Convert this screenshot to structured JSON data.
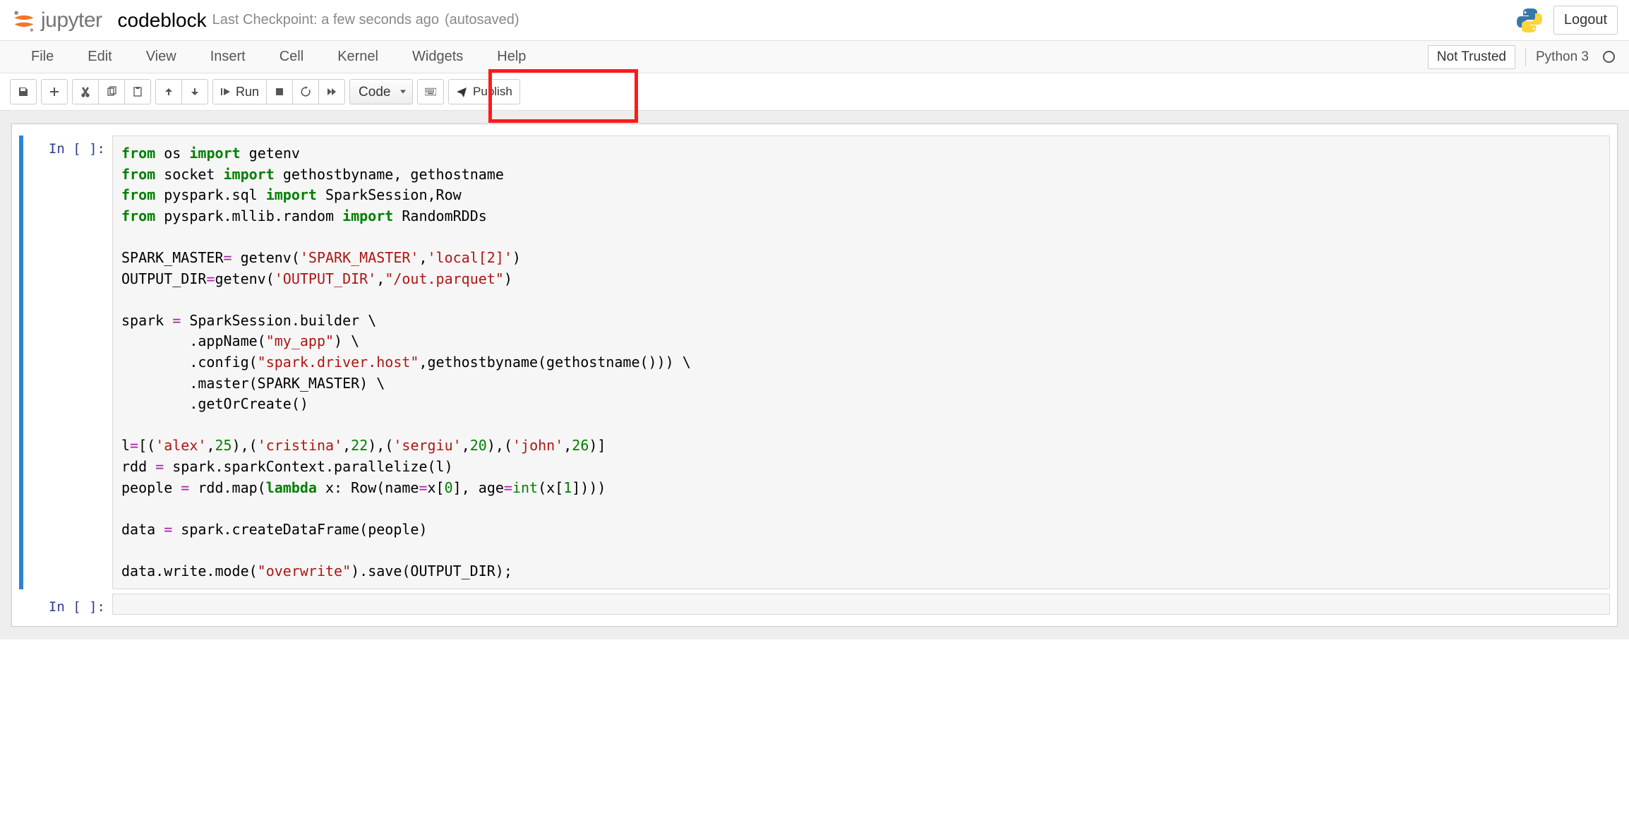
{
  "header": {
    "logo_text": "jupyter",
    "notebook_name": "codeblock",
    "checkpoint": "Last Checkpoint: a few seconds ago",
    "autosave": "(autosaved)",
    "logout": "Logout"
  },
  "menu": {
    "file": "File",
    "edit": "Edit",
    "view": "View",
    "insert": "Insert",
    "cell": "Cell",
    "kernel": "Kernel",
    "widgets": "Widgets",
    "help": "Help",
    "not_trusted": "Not Trusted",
    "kernel_name": "Python 3"
  },
  "toolbar": {
    "run_label": "Run",
    "celltype": "Code",
    "publish": "Publish"
  },
  "cells": {
    "prompt1": "In [ ]:",
    "prompt2": "In [ ]:"
  },
  "code": {
    "l1_from": "from",
    "l1_mod": "os",
    "l1_imp": "import",
    "l1_name": "getenv",
    "l2_from": "from",
    "l2_mod": "socket",
    "l2_imp": "import",
    "l2_names": "gethostbyname, gethostname",
    "l3_from": "from",
    "l3_mod": "pyspark.sql",
    "l3_imp": "import",
    "l3_names": "SparkSession,Row",
    "l4_from": "from",
    "l4_mod": "pyspark.mllib.random",
    "l4_imp": "import",
    "l4_name": "RandomRDDs",
    "l6a": "SPARK_MASTER",
    "l6eq": "=",
    "l6b": " getenv(",
    "l6s1": "'SPARK_MASTER'",
    "l6c": ",",
    "l6s2": "'local[2]'",
    "l6d": ")",
    "l7a": "OUTPUT_DIR",
    "l7eq": "=",
    "l7b": "getenv(",
    "l7s1": "'OUTPUT_DIR'",
    "l7c": ",",
    "l7s2": "\"/out.parquet\"",
    "l7d": ")",
    "l9a": "spark ",
    "l9eq": "=",
    "l9b": " SparkSession.builder \\",
    "l10a": "        .appName(",
    "l10s": "\"my_app\"",
    "l10b": ") \\",
    "l11a": "        .config(",
    "l11s": "\"spark.driver.host\"",
    "l11b": ",gethostbyname(gethostname())) \\",
    "l12a": "        .master(SPARK_MASTER) \\",
    "l13a": "        .getOrCreate()",
    "l15a": "l",
    "l15eq": "=",
    "l15b": "[(",
    "l15s1": "'alex'",
    "l15c1": ",",
    "l15n1": "25",
    "l15c2": "),(",
    "l15s2": "'cristina'",
    "l15c3": ",",
    "l15n2": "22",
    "l15c4": "),(",
    "l15s3": "'sergiu'",
    "l15c5": ",",
    "l15n3": "20",
    "l15c6": "),(",
    "l15s4": "'john'",
    "l15c7": ",",
    "l15n4": "26",
    "l15c8": ")]",
    "l16a": "rdd ",
    "l16eq": "=",
    "l16b": " spark.sparkContext.parallelize(l)",
    "l17a": "people ",
    "l17eq": "=",
    "l17b": " rdd.map(",
    "l17lam": "lambda",
    "l17c": " x: Row(name",
    "l17eq2": "=",
    "l17d": "x[",
    "l17n0": "0",
    "l17e": "], age",
    "l17eq3": "=",
    "l17int": "int",
    "l17f": "(x[",
    "l17n1": "1",
    "l17g": "])))",
    "l19a": "data ",
    "l19eq": "=",
    "l19b": " spark.createDataFrame(people)",
    "l21a": "data.write.mode(",
    "l21s": "\"overwrite\"",
    "l21b": ").save(OUTPUT_DIR);"
  }
}
